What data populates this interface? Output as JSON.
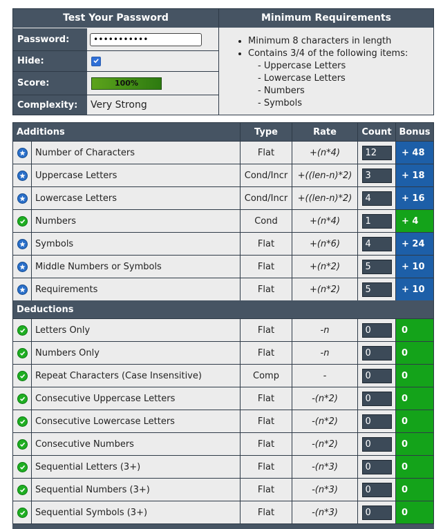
{
  "form": {
    "title": "Test Your Password",
    "password_label": "Password:",
    "password_value": "•••••••••••",
    "hide_label": "Hide:",
    "hide_checked": true,
    "score_label": "Score:",
    "score_text": "100%",
    "score_fraction": 1.0,
    "complexity_label": "Complexity:",
    "complexity_value": "Very Strong"
  },
  "requirements": {
    "title": "Minimum Requirements",
    "items": [
      "Minimum 8 characters in length",
      "Contains 3/4 of the following items:"
    ],
    "sub_items": [
      "- Uppercase Letters",
      "- Lowercase Letters",
      "- Numbers",
      "- Symbols"
    ]
  },
  "table": {
    "headers": {
      "additions": "Additions",
      "type": "Type",
      "rate": "Rate",
      "count": "Count",
      "bonus": "Bonus"
    },
    "deductions_label": "Deductions",
    "additions": [
      {
        "name": "Number of Characters",
        "type": "Flat",
        "rate": "+(n*4)",
        "count": "12",
        "bonus": "+ 48",
        "status": "exceeds"
      },
      {
        "name": "Uppercase Letters",
        "type": "Cond/Incr",
        "rate": "+((len-n)*2)",
        "count": "3",
        "bonus": "+ 18",
        "status": "exceeds"
      },
      {
        "name": "Lowercase Letters",
        "type": "Cond/Incr",
        "rate": "+((len-n)*2)",
        "count": "4",
        "bonus": "+ 16",
        "status": "exceeds"
      },
      {
        "name": "Numbers",
        "type": "Cond",
        "rate": "+(n*4)",
        "count": "1",
        "bonus": "+ 4",
        "status": "sufficient"
      },
      {
        "name": "Symbols",
        "type": "Flat",
        "rate": "+(n*6)",
        "count": "4",
        "bonus": "+ 24",
        "status": "exceeds"
      },
      {
        "name": "Middle Numbers or Symbols",
        "type": "Flat",
        "rate": "+(n*2)",
        "count": "5",
        "bonus": "+ 10",
        "status": "exceeds"
      },
      {
        "name": "Requirements",
        "type": "Flat",
        "rate": "+(n*2)",
        "count": "5",
        "bonus": "+ 10",
        "status": "exceeds"
      }
    ],
    "deductions": [
      {
        "name": "Letters Only",
        "type": "Flat",
        "rate": "-n",
        "count": "0",
        "bonus": "0",
        "status": "sufficient"
      },
      {
        "name": "Numbers Only",
        "type": "Flat",
        "rate": "-n",
        "count": "0",
        "bonus": "0",
        "status": "sufficient"
      },
      {
        "name": "Repeat Characters (Case Insensitive)",
        "type": "Comp",
        "rate": "-",
        "count": "0",
        "bonus": "0",
        "status": "sufficient"
      },
      {
        "name": "Consecutive Uppercase Letters",
        "type": "Flat",
        "rate": "-(n*2)",
        "count": "0",
        "bonus": "0",
        "status": "sufficient"
      },
      {
        "name": "Consecutive Lowercase Letters",
        "type": "Flat",
        "rate": "-(n*2)",
        "count": "0",
        "bonus": "0",
        "status": "sufficient"
      },
      {
        "name": "Consecutive Numbers",
        "type": "Flat",
        "rate": "-(n*2)",
        "count": "0",
        "bonus": "0",
        "status": "sufficient"
      },
      {
        "name": "Sequential Letters (3+)",
        "type": "Flat",
        "rate": "-(n*3)",
        "count": "0",
        "bonus": "0",
        "status": "sufficient"
      },
      {
        "name": "Sequential Numbers (3+)",
        "type": "Flat",
        "rate": "-(n*3)",
        "count": "0",
        "bonus": "0",
        "status": "sufficient"
      },
      {
        "name": "Sequential Symbols (3+)",
        "type": "Flat",
        "rate": "-(n*3)",
        "count": "0",
        "bonus": "0",
        "status": "sufficient"
      }
    ]
  },
  "colors": {
    "header_bg": "#465463",
    "cell_bg": "#ececec",
    "bonus_blue": "#1d5fa8",
    "bonus_green": "#14a31a",
    "score_green": "#2a6b12"
  }
}
